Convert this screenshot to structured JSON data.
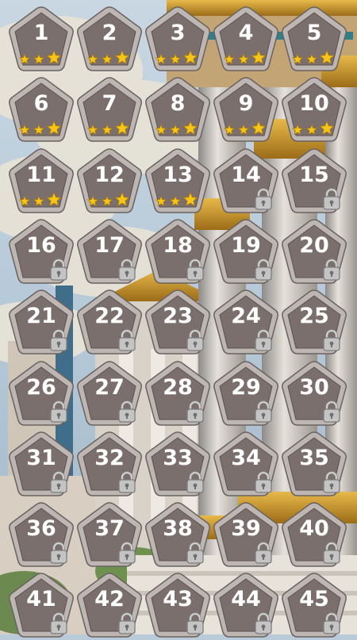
{
  "colors": {
    "tile_fill": "#7b6f6e",
    "tile_border": "#bdb6b3",
    "star": "#f5c518",
    "lock": "#c4c4c4"
  },
  "levels": [
    {
      "number": "1",
      "stars": 3,
      "locked": false
    },
    {
      "number": "2",
      "stars": 3,
      "locked": false
    },
    {
      "number": "3",
      "stars": 3,
      "locked": false
    },
    {
      "number": "4",
      "stars": 3,
      "locked": false
    },
    {
      "number": "5",
      "stars": 3,
      "locked": false
    },
    {
      "number": "6",
      "stars": 3,
      "locked": false
    },
    {
      "number": "7",
      "stars": 3,
      "locked": false
    },
    {
      "number": "8",
      "stars": 3,
      "locked": false
    },
    {
      "number": "9",
      "stars": 3,
      "locked": false
    },
    {
      "number": "10",
      "stars": 3,
      "locked": false
    },
    {
      "number": "11",
      "stars": 3,
      "locked": false
    },
    {
      "number": "12",
      "stars": 3,
      "locked": false
    },
    {
      "number": "13",
      "stars": 3,
      "locked": false
    },
    {
      "number": "14",
      "stars": 0,
      "locked": true
    },
    {
      "number": "15",
      "stars": 0,
      "locked": true
    },
    {
      "number": "16",
      "stars": 0,
      "locked": true
    },
    {
      "number": "17",
      "stars": 0,
      "locked": true
    },
    {
      "number": "18",
      "stars": 0,
      "locked": true
    },
    {
      "number": "19",
      "stars": 0,
      "locked": true
    },
    {
      "number": "20",
      "stars": 0,
      "locked": true
    },
    {
      "number": "21",
      "stars": 0,
      "locked": true
    },
    {
      "number": "22",
      "stars": 0,
      "locked": true
    },
    {
      "number": "23",
      "stars": 0,
      "locked": true
    },
    {
      "number": "24",
      "stars": 0,
      "locked": true
    },
    {
      "number": "25",
      "stars": 0,
      "locked": true
    },
    {
      "number": "26",
      "stars": 0,
      "locked": true
    },
    {
      "number": "27",
      "stars": 0,
      "locked": true
    },
    {
      "number": "28",
      "stars": 0,
      "locked": true
    },
    {
      "number": "29",
      "stars": 0,
      "locked": true
    },
    {
      "number": "30",
      "stars": 0,
      "locked": true
    },
    {
      "number": "31",
      "stars": 0,
      "locked": true
    },
    {
      "number": "32",
      "stars": 0,
      "locked": true
    },
    {
      "number": "33",
      "stars": 0,
      "locked": true
    },
    {
      "number": "34",
      "stars": 0,
      "locked": true
    },
    {
      "number": "35",
      "stars": 0,
      "locked": true
    },
    {
      "number": "36",
      "stars": 0,
      "locked": true
    },
    {
      "number": "37",
      "stars": 0,
      "locked": true
    },
    {
      "number": "38",
      "stars": 0,
      "locked": true
    },
    {
      "number": "39",
      "stars": 0,
      "locked": true
    },
    {
      "number": "40",
      "stars": 0,
      "locked": true
    },
    {
      "number": "41",
      "stars": 0,
      "locked": true
    },
    {
      "number": "42",
      "stars": 0,
      "locked": true
    },
    {
      "number": "43",
      "stars": 0,
      "locked": true
    },
    {
      "number": "44",
      "stars": 0,
      "locked": true
    },
    {
      "number": "45",
      "stars": 0,
      "locked": true
    }
  ]
}
